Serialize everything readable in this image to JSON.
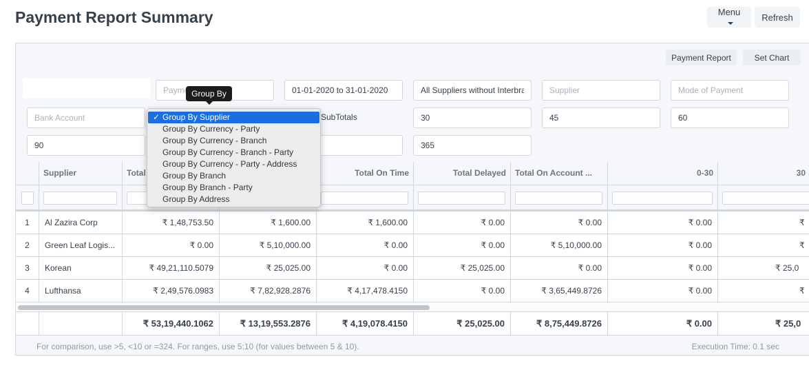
{
  "page": {
    "title": "Payment Report Summary"
  },
  "toolbar": {
    "menu_label": "Menu",
    "refresh_label": "Refresh"
  },
  "report_actions": {
    "payment_report_label": "Payment Report",
    "set_chart_label": "Set Chart"
  },
  "filters": {
    "company": "",
    "payment_placeholder": "Payment",
    "date_range": "01-01-2020 to 31-01-2020",
    "supplier_scope": "All Suppliers without Interbranch",
    "supplier_placeholder": "Supplier",
    "mode_of_payment_placeholder": "Mode of Payment",
    "bank_account_placeholder": "Bank Account",
    "subtotals_label": "SubTotals",
    "range1": "30",
    "range2": "45",
    "range3": "60",
    "range4": "90",
    "range5": "365"
  },
  "tooltip": {
    "text": "Group By"
  },
  "group_by": {
    "options": [
      "Group By Supplier",
      "Group By Currency - Party",
      "Group By Currency - Branch",
      "Group By Currency - Branch - Party",
      "Group By Currency - Party - Address",
      "Group By Branch",
      "Group By Branch - Party",
      "Group By Address"
    ],
    "selected_index": 0,
    "check_glyph": "✓"
  },
  "table": {
    "columns": [
      "",
      "Supplier",
      "Total",
      "",
      "Total On Time",
      "Total Delayed",
      "Total On Account ...",
      "0-30",
      "30"
    ],
    "rows": [
      [
        "1",
        "Al Zazira Corp",
        "₹ 1,48,753.50",
        "₹ 1,600.00",
        "₹ 1,600.00",
        "₹ 0.00",
        "₹ 0.00",
        "₹ 0.00",
        "₹"
      ],
      [
        "2",
        "Green Leaf Logis...",
        "₹ 0.00",
        "₹ 5,10,000.00",
        "₹ 0.00",
        "₹ 0.00",
        "₹ 5,10,000.00",
        "₹ 0.00",
        "₹"
      ],
      [
        "3",
        "Korean",
        "₹ 49,21,110.5079",
        "₹ 25,025.00",
        "₹ 0.00",
        "₹ 25,025.00",
        "₹ 0.00",
        "₹ 0.00",
        "₹ 25,0"
      ],
      [
        "4",
        "Lufthansa",
        "₹ 2,49,576.0983",
        "₹ 7,82,928.2876",
        "₹ 4,17,478.4150",
        "₹ 0.00",
        "₹ 3,65,449.8726",
        "₹ 0.00",
        "₹"
      ]
    ],
    "totals": [
      "",
      "",
      "₹ 53,19,440.1062",
      "₹ 13,19,553.2876",
      "₹ 4,19,078.4150",
      "₹ 25,025.00",
      "₹ 8,75,449.8726",
      "₹ 0.00",
      "₹ 25,0"
    ]
  },
  "footer": {
    "hint": "For comparison, use >5, <10 or =324. For ranges, use 5:10 (for values between 5 & 10).",
    "execution_time": "Execution Time: 0.1 sec"
  }
}
